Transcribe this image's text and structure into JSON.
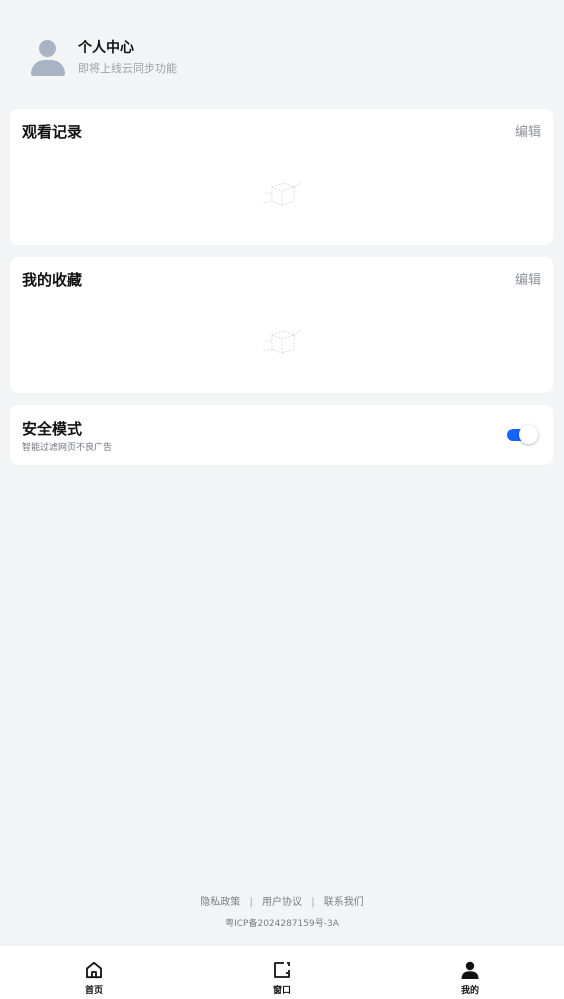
{
  "profile": {
    "name": "个人中心",
    "subtitle": "即将上线云同步功能"
  },
  "history": {
    "title": "观看记录",
    "edit_label": "编辑"
  },
  "favorites": {
    "title": "我的收藏",
    "edit_label": "编辑"
  },
  "safe_mode": {
    "title": "安全模式",
    "subtitle": "智能过滤网页不良广告",
    "enabled": true
  },
  "footer": {
    "links": [
      "隐私政策",
      "用户协议",
      "联系我们"
    ],
    "separator": "|",
    "icp": "粤ICP备2024287159号-3A"
  },
  "nav": {
    "items": [
      {
        "label": "首页",
        "icon": "home-icon"
      },
      {
        "label": "窗口",
        "icon": "window-icon"
      },
      {
        "label": "我的",
        "icon": "user-icon",
        "active": true
      }
    ]
  },
  "colors": {
    "background": "#f3f4f6",
    "accent": "#1664ff",
    "avatar": "#a9b3c6"
  }
}
